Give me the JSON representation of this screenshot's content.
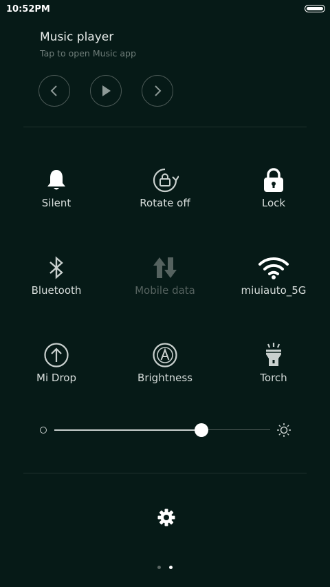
{
  "status": {
    "time": "10:52PM"
  },
  "music": {
    "title": "Music player",
    "subtitle": "Tap to open Music app",
    "controls": [
      "previous-icon",
      "play-icon",
      "next-icon"
    ]
  },
  "toggles": [
    {
      "label": "Silent",
      "icon": "bell-icon",
      "active": true
    },
    {
      "label": "Rotate off",
      "icon": "rotate-lock-icon",
      "active": false
    },
    {
      "label": "Lock",
      "icon": "lock-icon",
      "active": true
    },
    {
      "label": "Bluetooth",
      "icon": "bluetooth-icon",
      "active": false
    },
    {
      "label": "Mobile data",
      "icon": "mobile-data-icon",
      "active": false,
      "disabled": true
    },
    {
      "label": "miuiauto_5G",
      "icon": "wifi-icon",
      "active": true
    },
    {
      "label": "Mi Drop",
      "icon": "mi-drop-icon",
      "active": false
    },
    {
      "label": "Brightness",
      "icon": "auto-brightness-icon",
      "active": false
    },
    {
      "label": "Torch",
      "icon": "torch-icon",
      "active": false
    }
  ],
  "brightness": {
    "level": 0.68
  },
  "pager": {
    "pages": 2,
    "current": 2
  },
  "colors": {
    "background": "#061a17",
    "active": "#ffffff",
    "inactive": "#c9d0ce",
    "disabled": "#55625f"
  }
}
